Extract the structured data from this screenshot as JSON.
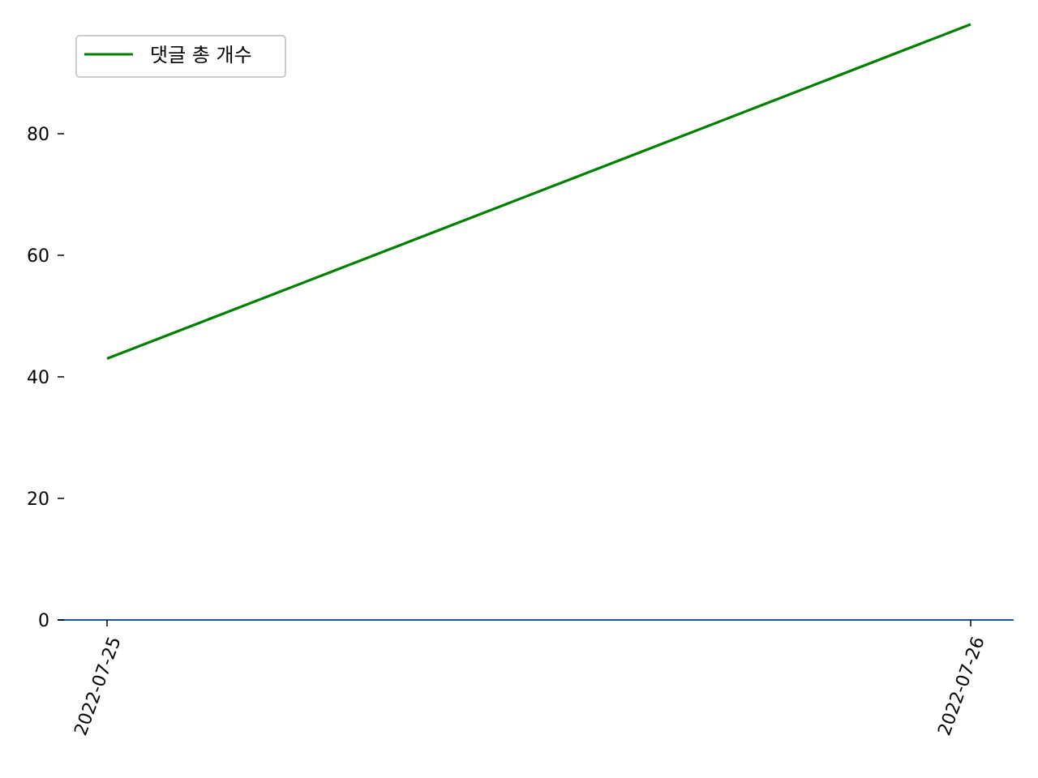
{
  "chart_data": {
    "type": "line",
    "x": [
      "2022-07-25",
      "2022-07-26"
    ],
    "xtick_labels": [
      "2022-07-25",
      "2022-07-26"
    ],
    "series": [
      {
        "name": "댓글 총 개수",
        "color": "#008000",
        "values": [
          43,
          98
        ]
      }
    ],
    "yticks": [
      0,
      20,
      40,
      60,
      80
    ],
    "ytick_labels": [
      "0",
      "20",
      "40",
      "60",
      "80"
    ],
    "ylim": [
      0,
      98
    ],
    "baseline": 0,
    "baseline_color": "#1f5a8c",
    "grid": false,
    "legend_position": "top-left",
    "xtick_rotation_deg": -70,
    "title": "",
    "xlabel": "",
    "ylabel": ""
  }
}
